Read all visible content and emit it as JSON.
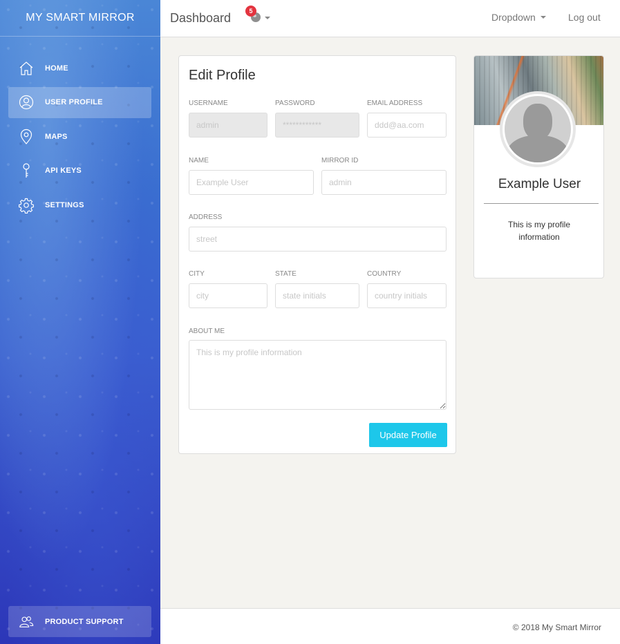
{
  "sidebar": {
    "brand": "MY SMART MIRROR",
    "items": [
      {
        "label": "HOME",
        "icon": "home-icon"
      },
      {
        "label": "USER PROFILE",
        "icon": "user-circle-icon",
        "active": true
      },
      {
        "label": "MAPS",
        "icon": "map-pin-icon"
      },
      {
        "label": "API KEYS",
        "icon": "key-icon"
      },
      {
        "label": "SETTINGS",
        "icon": "gear-icon"
      }
    ],
    "support": {
      "label": "PRODUCT SUPPORT",
      "icon": "users-icon"
    }
  },
  "navbar": {
    "title": "Dashboard",
    "notifications": {
      "count": "5",
      "icon": "globe-icon"
    },
    "dropdown_label": "Dropdown",
    "logout_label": "Log out"
  },
  "form": {
    "title": "Edit Profile",
    "username": {
      "label": "USERNAME",
      "placeholder": "admin"
    },
    "password": {
      "label": "PASSWORD",
      "placeholder": "************"
    },
    "email": {
      "label": "EMAIL ADDRESS",
      "placeholder": "ddd@aa.com"
    },
    "name": {
      "label": "NAME",
      "placeholder": "Example User"
    },
    "mirror_id": {
      "label": "MIRROR ID",
      "placeholder": "admin"
    },
    "address": {
      "label": "ADDRESS",
      "placeholder": "street"
    },
    "city": {
      "label": "CITY",
      "placeholder": "city"
    },
    "state": {
      "label": "STATE",
      "placeholder": "state initials"
    },
    "country": {
      "label": "COUNTRY",
      "placeholder": "country initials"
    },
    "about": {
      "label": "ABOUT ME",
      "placeholder": "This is my profile information"
    },
    "submit_label": "Update Profile"
  },
  "user_card": {
    "name": "Example User",
    "description": "This is my profile information"
  },
  "footer": {
    "copyright": "© 2018 My Smart Mirror"
  },
  "colors": {
    "accent": "#1dc7ea",
    "badge": "#e3343f",
    "sidebar_top": "#4a86d6",
    "sidebar_bottom": "#2c36b8"
  }
}
